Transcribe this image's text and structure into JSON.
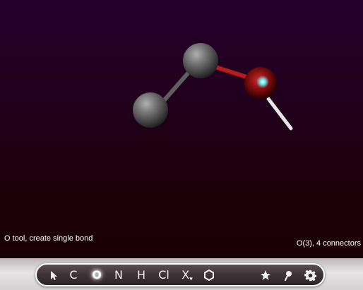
{
  "status": {
    "left_text": "O tool, create single bond",
    "right_text": "O(3), 4 connectors"
  },
  "toolbar": {
    "tools": [
      {
        "id": "select",
        "label": "",
        "icon": "arrow-cursor-icon"
      },
      {
        "id": "carbon",
        "label": "C"
      },
      {
        "id": "oxygen",
        "label": "O",
        "active": true
      },
      {
        "id": "nitrogen",
        "label": "N"
      },
      {
        "id": "hydrogen",
        "label": "H"
      },
      {
        "id": "chlorine",
        "label": "Cl"
      },
      {
        "id": "other-element",
        "label": "X",
        "sub": "▾"
      },
      {
        "id": "ring",
        "label": "",
        "icon": "hexagon-icon"
      },
      {
        "id": "favorite",
        "label": "",
        "icon": "star-icon"
      },
      {
        "id": "probe",
        "label": "",
        "icon": "pin-icon"
      },
      {
        "id": "settings",
        "label": "",
        "icon": "gear-icon"
      }
    ]
  },
  "colors": {
    "background_top": "#25002c",
    "background_bottom": "#1a0004",
    "carbon_atom": "#6a6a6a",
    "oxygen_atom": "#8a1010",
    "selection_highlight": "#5ef0f0",
    "bond_gray": "#5c5c5c",
    "bond_red": "#b51c1c",
    "bond_white": "#e8e8e8"
  }
}
